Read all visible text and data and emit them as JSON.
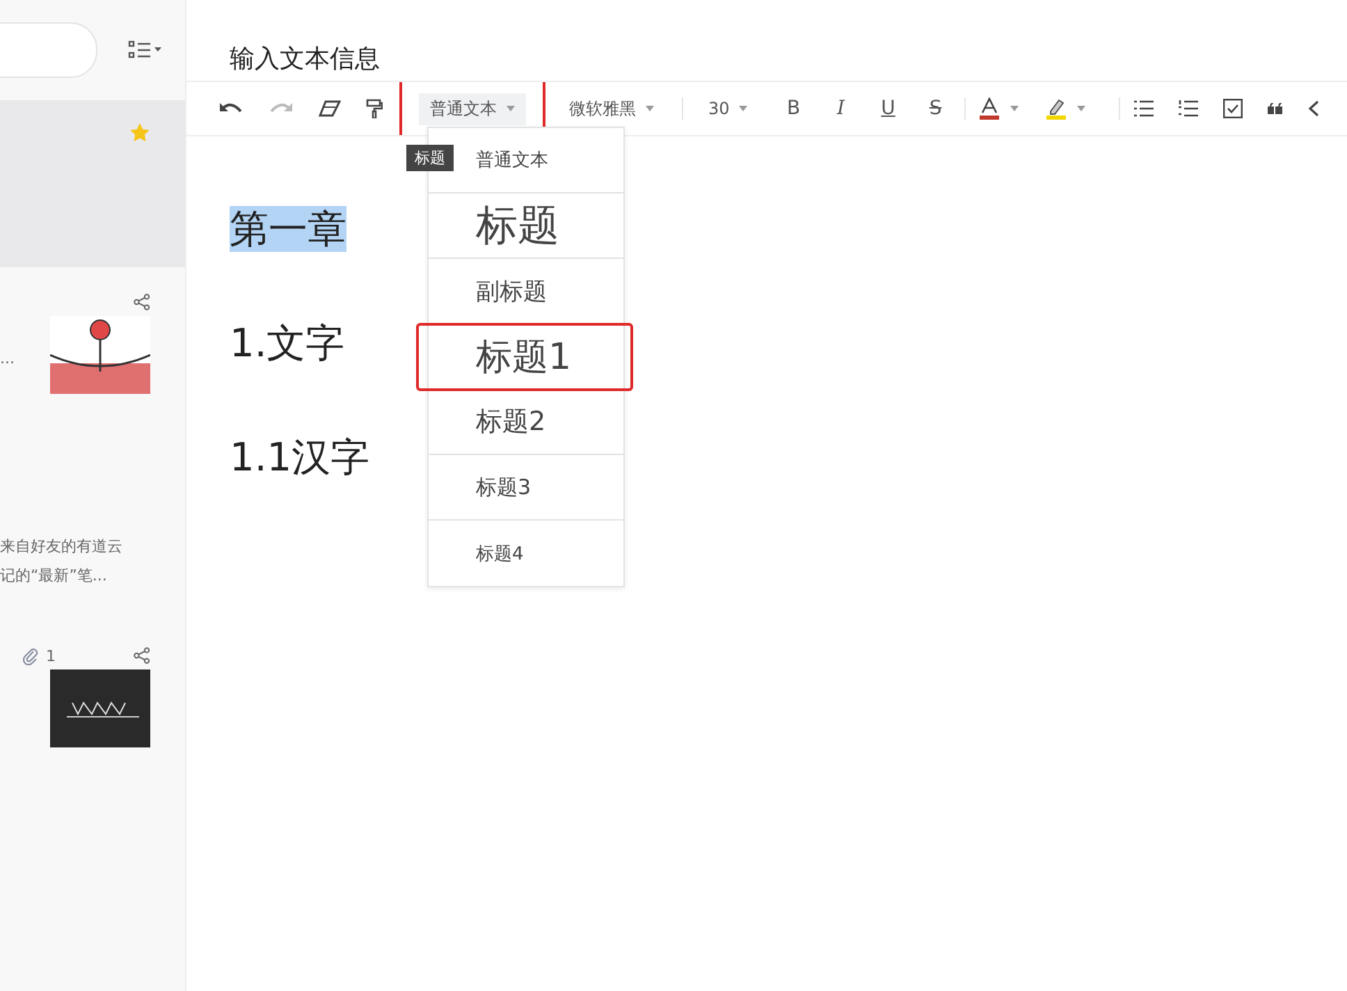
{
  "sidebar": {
    "notes": [
      {
        "selected": true,
        "starred": true,
        "shared": false,
        "kind": "plain"
      },
      {
        "selected": false,
        "starred": false,
        "shared": true,
        "lines": [
          "..."
        ],
        "kind": "cartoon"
      },
      {
        "selected": false,
        "starred": false,
        "shared": false,
        "lines": [
          "来自好友的有道云",
          "记的“最新”笔..."
        ],
        "kind": "plain"
      },
      {
        "selected": false,
        "starred": false,
        "shared": true,
        "attachments": "1",
        "kind": "dark"
      }
    ]
  },
  "editor": {
    "title": "输入文本信息",
    "toolbar": {
      "redo_disabled": true,
      "style_dropdown": {
        "label": "普通文本",
        "highlighted": true
      },
      "font_dropdown": {
        "label": "微软雅黑"
      },
      "size_dropdown": {
        "label": "30"
      },
      "format_buttons": [
        "B",
        "I",
        "U",
        "S"
      ]
    },
    "tooltip": "标题",
    "style_menu": [
      {
        "label": "普通文本",
        "kind": "normal",
        "highlighted": false
      },
      {
        "label": "标题",
        "kind": "title",
        "highlighted": false
      },
      {
        "label": "副标题",
        "kind": "subtitle",
        "highlighted": false
      },
      {
        "label": "标题1",
        "kind": "h1",
        "highlighted": true
      },
      {
        "label": "标题2",
        "kind": "h2",
        "highlighted": false
      },
      {
        "label": "标题3",
        "kind": "h3",
        "highlighted": false
      },
      {
        "label": "标题4",
        "kind": "h4",
        "highlighted": false
      }
    ],
    "content": [
      {
        "text": "第一章",
        "selected": true
      },
      {
        "text": "1.文字",
        "selected": false
      },
      {
        "text": "1.1汉字",
        "selected": false
      }
    ]
  }
}
